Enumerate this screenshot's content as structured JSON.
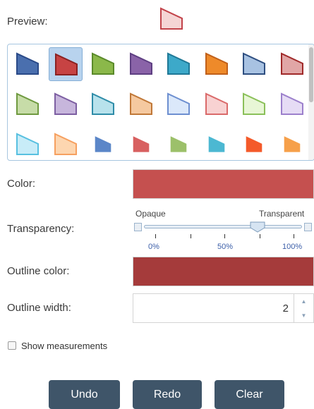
{
  "preview": {
    "label": "Preview:",
    "fill": "#f5d5d5",
    "stroke": "#c2434a"
  },
  "palette": {
    "selected_index": 1,
    "rows": [
      [
        {
          "fill": "#4a6fae",
          "stroke": "#2a4a88"
        },
        {
          "fill": "#c74343",
          "stroke": "#8b2222"
        },
        {
          "fill": "#8bb84a",
          "stroke": "#5a8a2a"
        },
        {
          "fill": "#8a63a8",
          "stroke": "#5e3f82"
        },
        {
          "fill": "#3da9c9",
          "stroke": "#1f7896"
        },
        {
          "fill": "#ee8a2a",
          "stroke": "#c0601a"
        },
        {
          "fill": "#a8c2e2",
          "stroke": "#2e4e80"
        },
        {
          "fill": "#e1a6a6",
          "stroke": "#a02a2a"
        }
      ],
      [
        {
          "fill": "#c7dca8",
          "stroke": "#6f9a40"
        },
        {
          "fill": "#c7b6dc",
          "stroke": "#7d5fa2"
        },
        {
          "fill": "#b8e2ec",
          "stroke": "#2f8ca8"
        },
        {
          "fill": "#f5c9a0",
          "stroke": "#c07838"
        },
        {
          "fill": "#dbe8fa",
          "stroke": "#6d8fd0"
        },
        {
          "fill": "#f8d2d2",
          "stroke": "#da6a6a"
        },
        {
          "fill": "#e8f6d6",
          "stroke": "#8bc05a"
        },
        {
          "fill": "#e6dcf5",
          "stroke": "#9c80cc"
        }
      ],
      [
        {
          "fill": "#c8ecf8",
          "stroke": "#58c0e0"
        },
        {
          "fill": "#fdd6b0",
          "stroke": "#f6a060"
        },
        {
          "fill": "#5b86c8",
          "stroke": "#5b86c8"
        },
        {
          "fill": "#d86060",
          "stroke": "#d86060"
        },
        {
          "fill": "#9cc06a",
          "stroke": "#9cc06a"
        },
        {
          "fill": "#4cb8d2",
          "stroke": "#4cb8d2"
        },
        {
          "fill": "#f45a2a",
          "stroke": "#f45a2a"
        },
        {
          "fill": "#f6a04a",
          "stroke": "#f6a04a"
        }
      ]
    ]
  },
  "color": {
    "label": "Color:",
    "value": "#c5504f"
  },
  "transparency": {
    "label": "Transparency:",
    "opaque_label": "Opaque",
    "transparent_label": "Transparent",
    "value_fraction": 0.72,
    "ticks": [
      "0%",
      "50%",
      "100%"
    ]
  },
  "outline_color": {
    "label": "Outline color:",
    "value": "#a53b3b"
  },
  "outline_width": {
    "label": "Outline width:",
    "value": "2"
  },
  "show_measurements": {
    "label": "Show measurements",
    "checked": false
  },
  "buttons": {
    "undo": "Undo",
    "redo": "Redo",
    "clear": "Clear"
  }
}
